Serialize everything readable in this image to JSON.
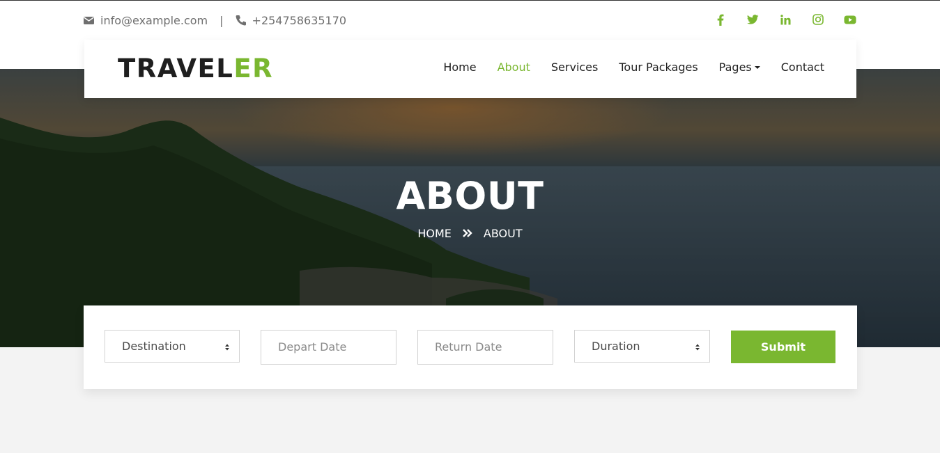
{
  "topbar": {
    "email": "info@example.com",
    "separator": "|",
    "phone": "+254758635170",
    "social_icons": [
      "facebook-icon",
      "twitter-icon",
      "linkedin-icon",
      "instagram-icon",
      "youtube-icon"
    ]
  },
  "brand": {
    "logo_main": "TRAVEL",
    "logo_accent": "ER",
    "accent_color": "#7ab730"
  },
  "nav": {
    "items": [
      {
        "label": "Home"
      },
      {
        "label": "About",
        "active": true
      },
      {
        "label": "Services"
      },
      {
        "label": "Tour Packages"
      },
      {
        "label": "Pages",
        "dropdown": true
      },
      {
        "label": "Contact"
      }
    ]
  },
  "hero": {
    "title": "ABOUT",
    "breadcrumb": {
      "home": "HOME",
      "current": "ABOUT"
    }
  },
  "booking": {
    "destination": "Destination",
    "depart_placeholder": "Depart Date",
    "return_placeholder": "Return Date",
    "duration": "Duration",
    "submit_label": "Submit"
  }
}
